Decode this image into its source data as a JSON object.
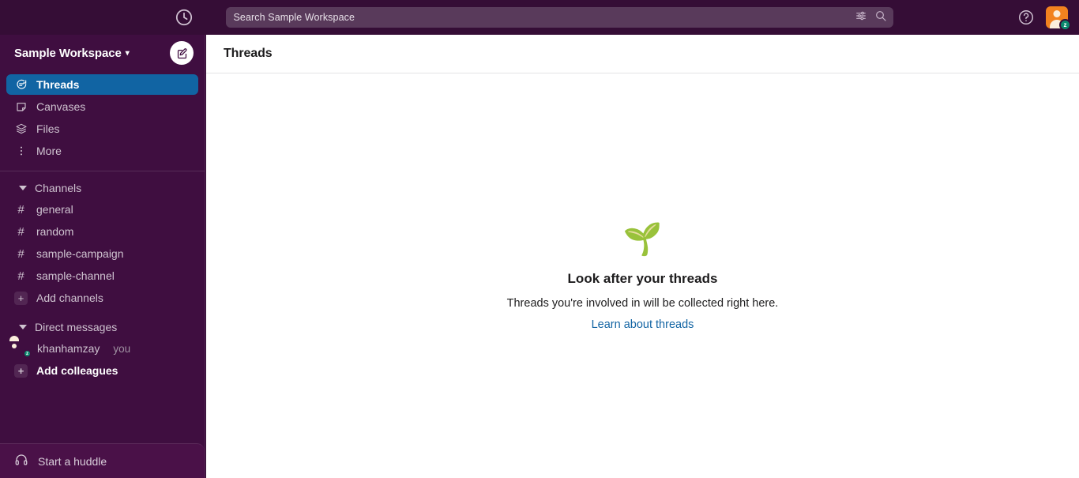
{
  "topbar": {
    "history_icon": "clock-history-icon",
    "search": {
      "placeholder": "Search Sample Workspace",
      "value": "Search Sample Workspace",
      "filter_icon": "filter-sliders-icon",
      "search_icon": "search-icon"
    },
    "help_icon": "help-question-icon",
    "avatar": {
      "name": "avatar",
      "presence": "z",
      "presence_label": "away",
      "color": "#F2821F",
      "badge_color": "#0B8A6E"
    }
  },
  "sidebar": {
    "workspace_name": "Sample Workspace",
    "workspace_chevron": "⌄",
    "compose_icon": "compose-pencil-icon",
    "nav": [
      {
        "label": "Threads",
        "icon": "threads-icon",
        "active": true
      },
      {
        "label": "Canvases",
        "icon": "canvas-icon",
        "active": false
      },
      {
        "label": "Files",
        "icon": "files-stack-icon",
        "active": false
      },
      {
        "label": "More",
        "icon": "more-dots-icon",
        "active": false
      }
    ],
    "channels_section": {
      "label": "Channels",
      "items": [
        {
          "label": "general"
        },
        {
          "label": "random"
        },
        {
          "label": "sample-campaign"
        },
        {
          "label": "sample-channel"
        }
      ],
      "add_label": "Add channels",
      "add_symbol": "+"
    },
    "dm_section": {
      "label": "Direct messages",
      "items": [
        {
          "label": "khanhamzay",
          "you_tag": "you",
          "presence": "z"
        }
      ],
      "add_label": "Add colleagues",
      "add_symbol": "+"
    },
    "huddle": {
      "label": "Start a huddle",
      "icon": "headphones-icon"
    }
  },
  "main": {
    "title": "Threads",
    "empty_state": {
      "emoji": "🌱",
      "emoji_name": "seedling-emoji",
      "title": "Look after your threads",
      "description": "Threads you're involved in will be collected right here.",
      "link": "Learn about threads"
    }
  },
  "colors": {
    "sidebar_bg": "#3F0E40",
    "topbar_bg": "#350D36",
    "active_item": "#1164A3",
    "link": "#1264A3",
    "huddle_bg": "#4A1148"
  }
}
